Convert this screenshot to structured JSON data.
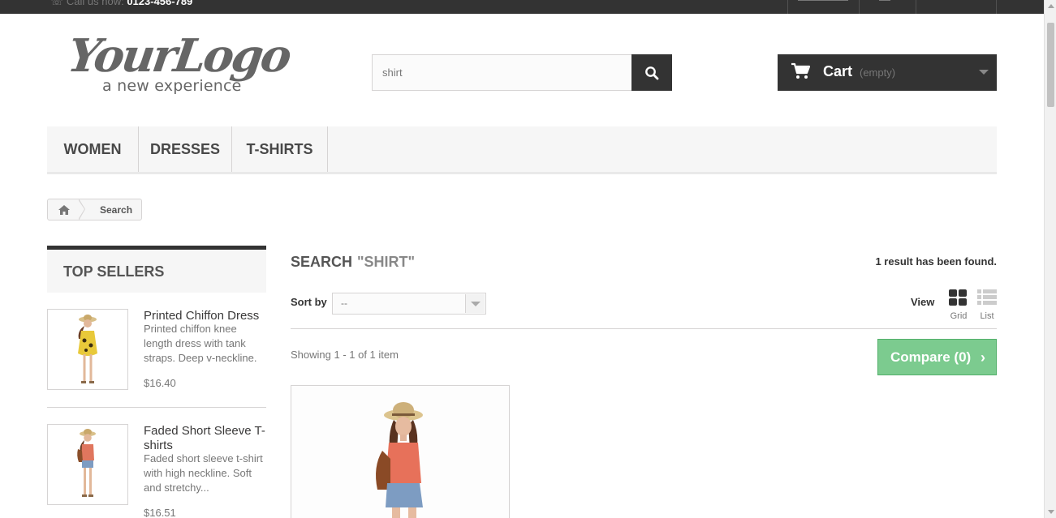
{
  "topbar": {
    "call_label": "Call us now:",
    "phone": "0123-456-789"
  },
  "logo": {
    "script": "YourLogo",
    "tagline": "a new experience"
  },
  "search": {
    "value": "shirt",
    "button_icon": "search-icon"
  },
  "cart": {
    "label": "Cart",
    "status": "(empty)",
    "icon": "cart-icon"
  },
  "menu": {
    "items": [
      {
        "label": "WOMEN"
      },
      {
        "label": "DRESSES"
      },
      {
        "label": "T-SHIRTS"
      }
    ]
  },
  "breadcrumb": {
    "home_icon": "home-icon",
    "current": "Search"
  },
  "sidebar": {
    "title": "TOP SELLERS",
    "products": [
      {
        "name": "Printed Chiffon Dress",
        "description": "Printed chiffon knee length dress with tank straps. Deep v-neckline.",
        "price": "$16.40"
      },
      {
        "name": "Faded Short Sleeve T-shirts",
        "description": "Faded short sleeve t-shirt with high neckline. Soft and stretchy...",
        "price": "$16.51"
      }
    ]
  },
  "main": {
    "title": "SEARCH",
    "query": "\"SHIRT\"",
    "result_count": "1 result has been found.",
    "sort_label": "Sort by",
    "sort_value": "--",
    "view_label": "View",
    "view_grid": "Grid",
    "view_list": "List",
    "showing": "Showing 1 - 1 of 1 item",
    "compare_label": "Compare (0)"
  },
  "colors": {
    "dark": "#333333",
    "compare_green": "#7ccb8f",
    "menu_bg": "#f6f6f6",
    "border": "#d6d4d4"
  }
}
